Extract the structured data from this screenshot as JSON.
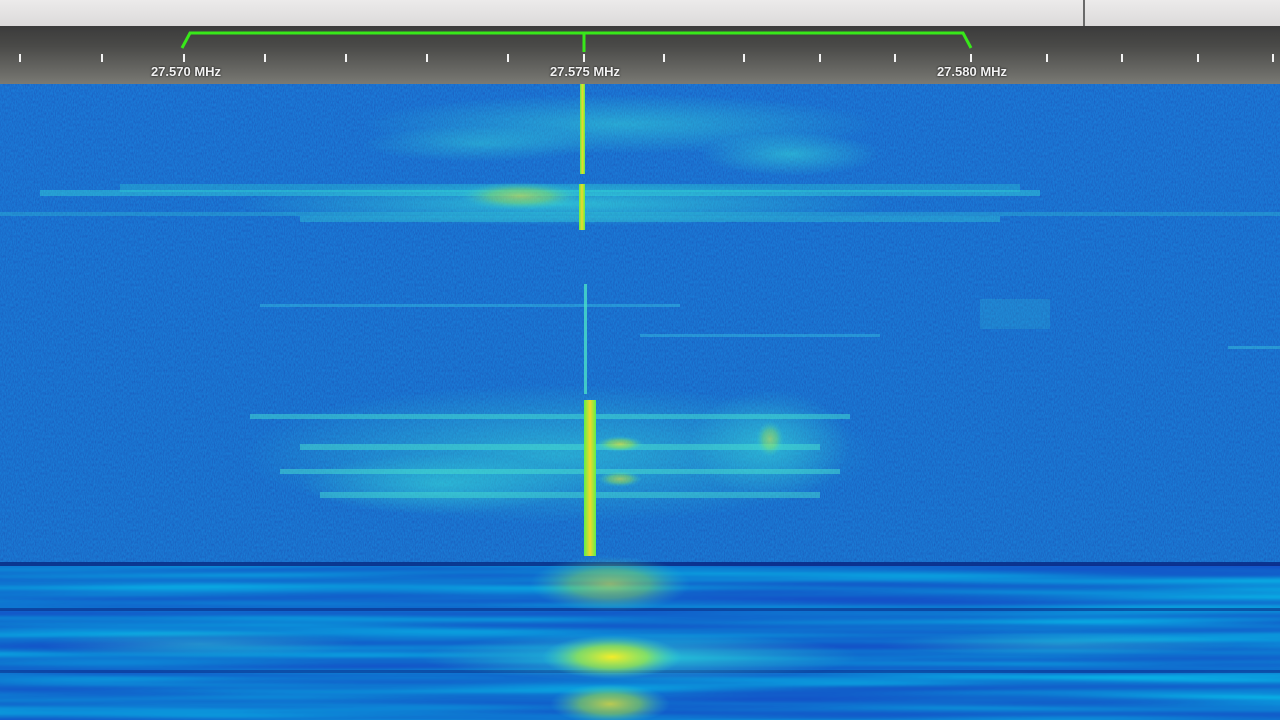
{
  "frequency_scale": {
    "unit": "MHz",
    "labels": [
      "27.570 MHz",
      "27.575 MHz",
      "27.580 MHz"
    ],
    "tuned_center": "27.575 MHz",
    "passband_low": "27.570 MHz",
    "passband_high": "27.580 MHz"
  },
  "colors": {
    "passband_bracket": "#38e81a",
    "center_marker": "#38e81a",
    "noise_floor": "#1d4fc8",
    "signal_cyan": "#2ee0e0",
    "signal_peak": "#f0e02a"
  },
  "waterfall": {
    "description_icon": "spectrogram-waterfall"
  }
}
